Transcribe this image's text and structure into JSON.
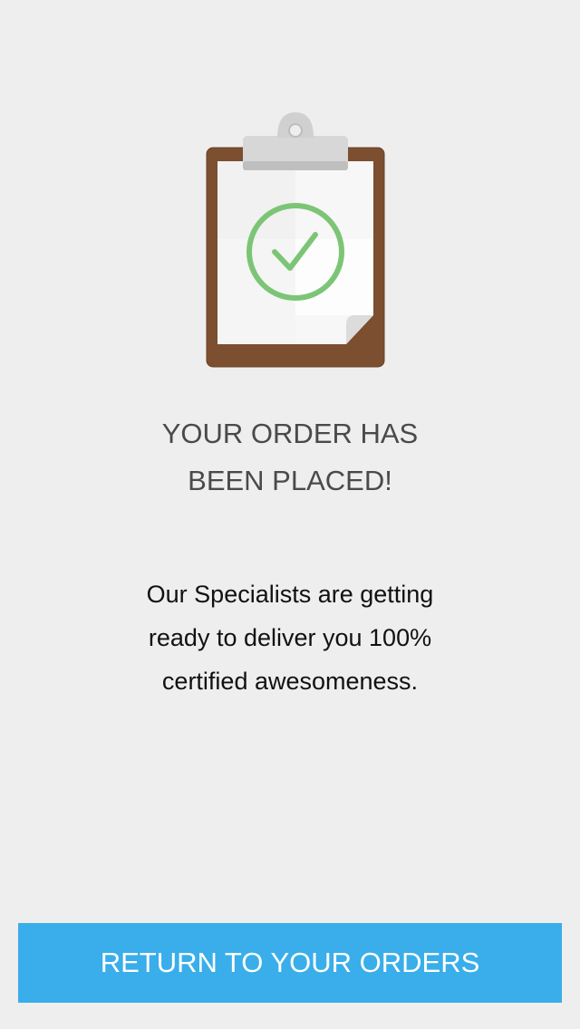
{
  "confirmation": {
    "illustration_icon": "clipboard-check-icon",
    "headline_line1": "YOUR ORDER HAS",
    "headline_line2": "BEEN PLACED!",
    "message_line1": "Our Specialists are getting",
    "message_line2": "ready to deliver you 100%",
    "message_line3": "certified awesomeness."
  },
  "actions": {
    "return_label": "RETURN TO YOUR ORDERS"
  },
  "colors": {
    "background": "#eeeeee",
    "accent": "#39aeea",
    "check_green": "#7cc576",
    "clipboard_brown": "#7b4f30"
  }
}
